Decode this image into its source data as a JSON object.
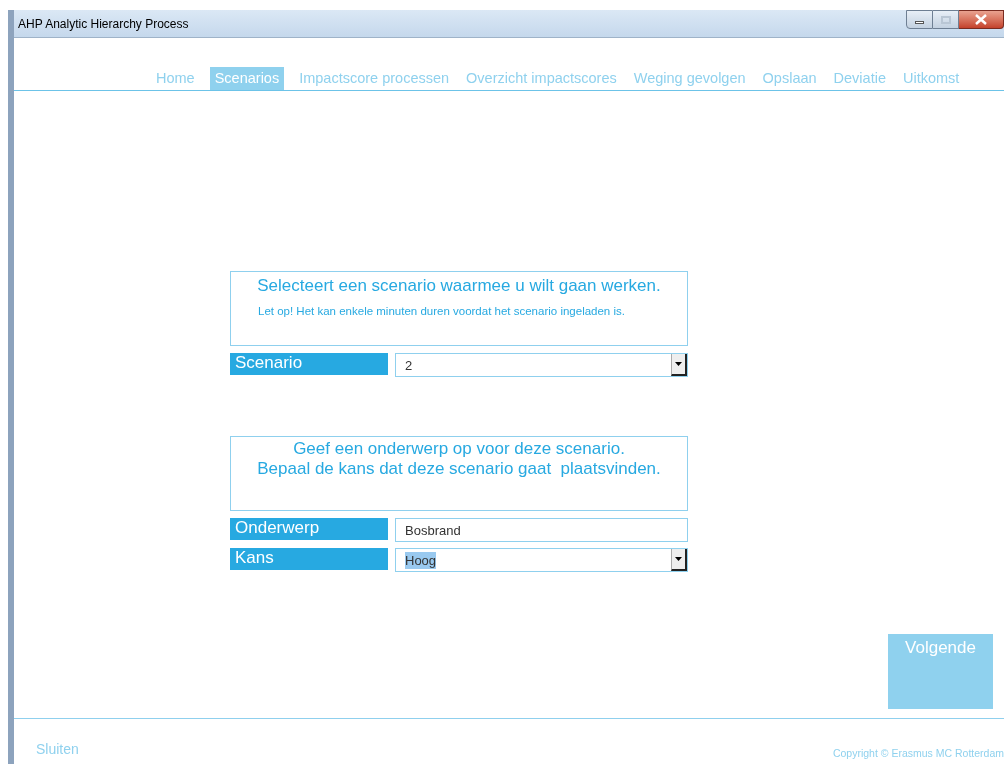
{
  "window": {
    "title": "AHP Analytic Hierarchy Process"
  },
  "tabs": [
    {
      "label": "Home",
      "selected": false
    },
    {
      "label": "Scenarios",
      "selected": true
    },
    {
      "label": "Impactscore processen",
      "selected": false
    },
    {
      "label": "Overzicht impactscores",
      "selected": false
    },
    {
      "label": "Weging gevolgen",
      "selected": false
    },
    {
      "label": "Opslaan",
      "selected": false
    },
    {
      "label": "Deviatie",
      "selected": false
    },
    {
      "label": "Uitkomst",
      "selected": false
    }
  ],
  "scenario_section": {
    "heading": "Selecteert een scenario waarmee u wilt gaan werken.",
    "note": "Let op! Het kan enkele minuten duren voordat het scenario ingeladen is.",
    "fields": [
      {
        "kind": "dropdown",
        "label": "Scenario",
        "value": "2",
        "text_selected": false
      }
    ]
  },
  "subject_section": {
    "lines": [
      "Geef een onderwerp op voor deze scenario.",
      "Bepaal de kans dat deze scenario gaat  plaatsvinden."
    ],
    "fields": [
      {
        "kind": "text",
        "label": "Onderwerp",
        "value": "Bosbrand",
        "text_selected": false
      },
      {
        "kind": "dropdown",
        "label": "Kans",
        "value": "Hoog",
        "text_selected": true
      }
    ]
  },
  "next_button": "Volgende",
  "close_link": "Sluiten",
  "copyright": "Copyright © Erasmus MC Rotterdam"
}
